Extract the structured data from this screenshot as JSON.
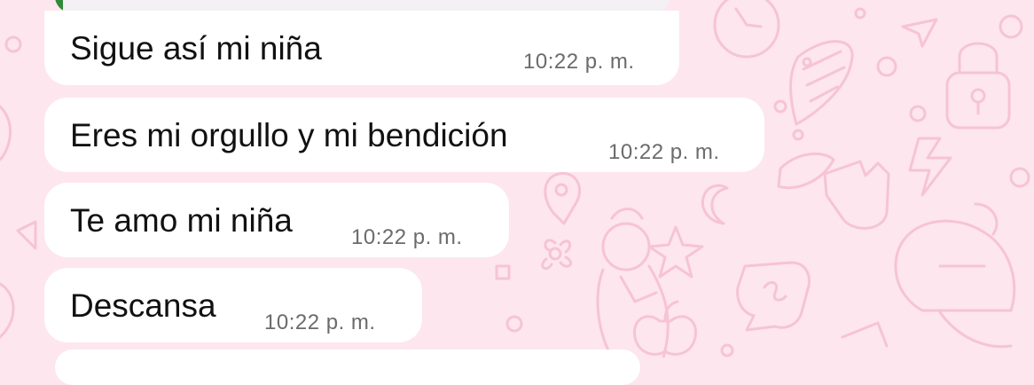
{
  "colors": {
    "background": "#fde6ee",
    "bubble": "#ffffff",
    "quote_accent": "#2e8b3a",
    "text": "#111111",
    "timestamp": "#6b6b6b"
  },
  "messages": [
    {
      "text": "Sigue así mi niña",
      "time": "10:22 p. m."
    },
    {
      "text": "Eres mi orgullo y mi bendición",
      "time": "10:22 p. m."
    },
    {
      "text": "Te amo mi niña",
      "time": "10:22 p. m."
    },
    {
      "text": "Descansa",
      "time": "10:22 p. m."
    }
  ]
}
